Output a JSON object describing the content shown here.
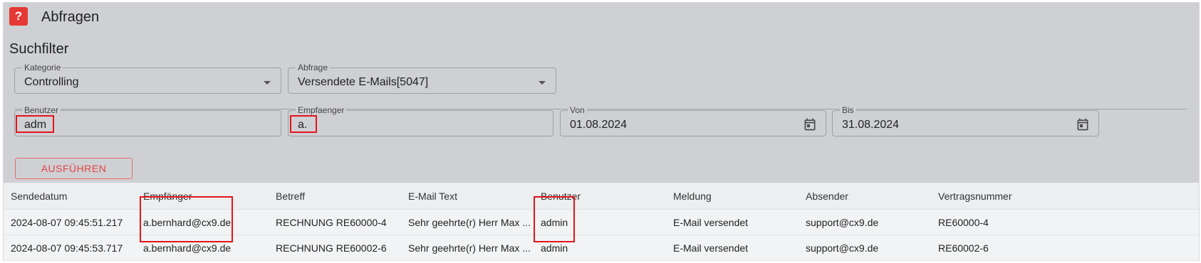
{
  "app": {
    "title": "Abfragen",
    "icon": "help-question-icon",
    "icon_glyph": "?"
  },
  "filter": {
    "section_title": "Suchfilter",
    "kategorie": {
      "label": "Kategorie",
      "value": "Controlling"
    },
    "abfrage": {
      "label": "Abfrage",
      "value": "Versendete E-Mails[5047]"
    },
    "benutzer": {
      "label": "Benutzer",
      "value": "adm"
    },
    "empfaenger": {
      "label": "Empfaenger",
      "value": "a."
    },
    "von": {
      "label": "Von",
      "value": "01.08.2024"
    },
    "bis": {
      "label": "Bis",
      "value": "31.08.2024"
    },
    "run_label": "AUSFÜHREN"
  },
  "table": {
    "columns": [
      "Sendedatum",
      "Empfänger",
      "Betreff",
      "E-Mail Text",
      "Benutzer",
      "Meldung",
      "Absender",
      "Vertragsnummer"
    ],
    "rows": [
      [
        "2024-08-07 09:45:51.217",
        "a.bernhard@cx9.de",
        "RECHNUNG RE60000-4",
        "Sehr geehrte(r) Herr Max ...",
        "admin",
        "E-Mail versendet",
        "support@cx9.de",
        "RE60000-4"
      ],
      [
        "2024-08-07 09:45:53.717",
        "a.bernhard@cx9.de",
        "RECHNUNG RE60002-6",
        "Sehr geehrte(r) Herr Max ...",
        "admin",
        "E-Mail versendet",
        "support@cx9.de",
        "RE60002-6"
      ]
    ]
  },
  "colors": {
    "panel": "#cfd0d4",
    "accent_red": "#e53935",
    "highlight": "#e0161b"
  }
}
